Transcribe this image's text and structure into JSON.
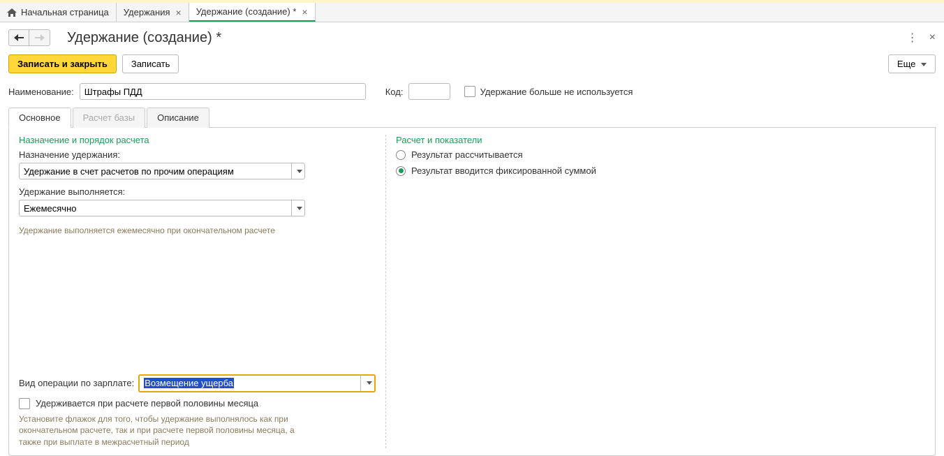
{
  "tabs": {
    "home": "Начальная страница",
    "tab1": "Удержания",
    "tab2": "Удержание (создание) *"
  },
  "title": "Удержание (создание) *",
  "buttons": {
    "save_close": "Записать и закрыть",
    "save": "Записать",
    "more": "Еще"
  },
  "header": {
    "name_label": "Наименование:",
    "name_value": "Штрафы ПДД",
    "code_label": "Код:",
    "code_value": "",
    "unused_label": "Удержание больше не используется"
  },
  "inner_tabs": {
    "main": "Основное",
    "base": "Расчет базы",
    "desc": "Описание"
  },
  "left": {
    "section": "Назначение и порядок расчета",
    "purpose_label": "Назначение удержания:",
    "purpose_value": "Удержание в счет расчетов по прочим операциям",
    "exec_label": "Удержание выполняется:",
    "exec_value": "Ежемесячно",
    "exec_hint": "Удержание выполняется ежемесячно при окончательном расчете",
    "op_label": "Вид операции по зарплате:",
    "op_value": "Возмещение ущерба",
    "first_half_label": "Удерживается при расчете первой половины месяца",
    "first_half_hint": "Установите флажок для того, чтобы удержание выполнялось как при окончательном расчете, так и при расчете первой половины месяца, а также при выплате в межрасчетный период"
  },
  "right": {
    "section": "Расчет и показатели",
    "radio1": "Результат рассчитывается",
    "radio2": "Результат вводится фиксированной суммой"
  }
}
